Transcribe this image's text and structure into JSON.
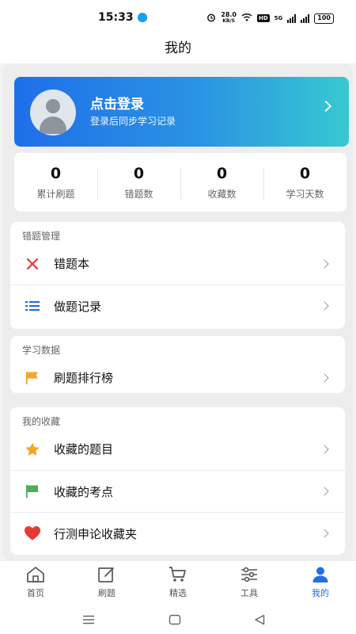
{
  "status_bar": {
    "time": "15:33",
    "net_speed_value": "28.0",
    "net_speed_unit": "KB/S",
    "hd": "HD",
    "network": "5G",
    "battery": "100"
  },
  "header": {
    "title": "我的"
  },
  "login": {
    "title": "点击登录",
    "subtitle": "登录后同步学习记录"
  },
  "stats": [
    {
      "value": "0",
      "label": "累计刷题"
    },
    {
      "value": "0",
      "label": "错题数"
    },
    {
      "value": "0",
      "label": "收藏数"
    },
    {
      "value": "0",
      "label": "学习天数"
    }
  ],
  "sections": {
    "mistakes": {
      "title": "错题管理",
      "items": [
        {
          "label": "错题本",
          "icon": "x-icon"
        },
        {
          "label": "做题记录",
          "icon": "list-icon"
        }
      ]
    },
    "study": {
      "title": "学习数据",
      "items": [
        {
          "label": "刷题排行榜",
          "icon": "flag-icon"
        }
      ]
    },
    "favorites": {
      "title": "我的收藏",
      "items": [
        {
          "label": "收藏的题目",
          "icon": "star-icon"
        },
        {
          "label": "收藏的考点",
          "icon": "green-flag-icon"
        },
        {
          "label": "行测申论收藏夹",
          "icon": "heart-icon"
        }
      ]
    }
  },
  "tabs": [
    {
      "label": "首页",
      "icon": "home-icon"
    },
    {
      "label": "刷题",
      "icon": "edit-icon"
    },
    {
      "label": "精选",
      "icon": "cart-icon"
    },
    {
      "label": "工具",
      "icon": "sliders-icon"
    },
    {
      "label": "我的",
      "icon": "user-icon",
      "active": true
    }
  ],
  "colors": {
    "accent": "#1f6fe8",
    "gradient_end": "#37c9d0",
    "mistake_red": "#e53935",
    "list_blue": "#1f6fe8",
    "flag_orange": "#f5a623",
    "star_orange": "#f5a623",
    "flag_green": "#4caf50",
    "heart_red": "#e53935"
  }
}
